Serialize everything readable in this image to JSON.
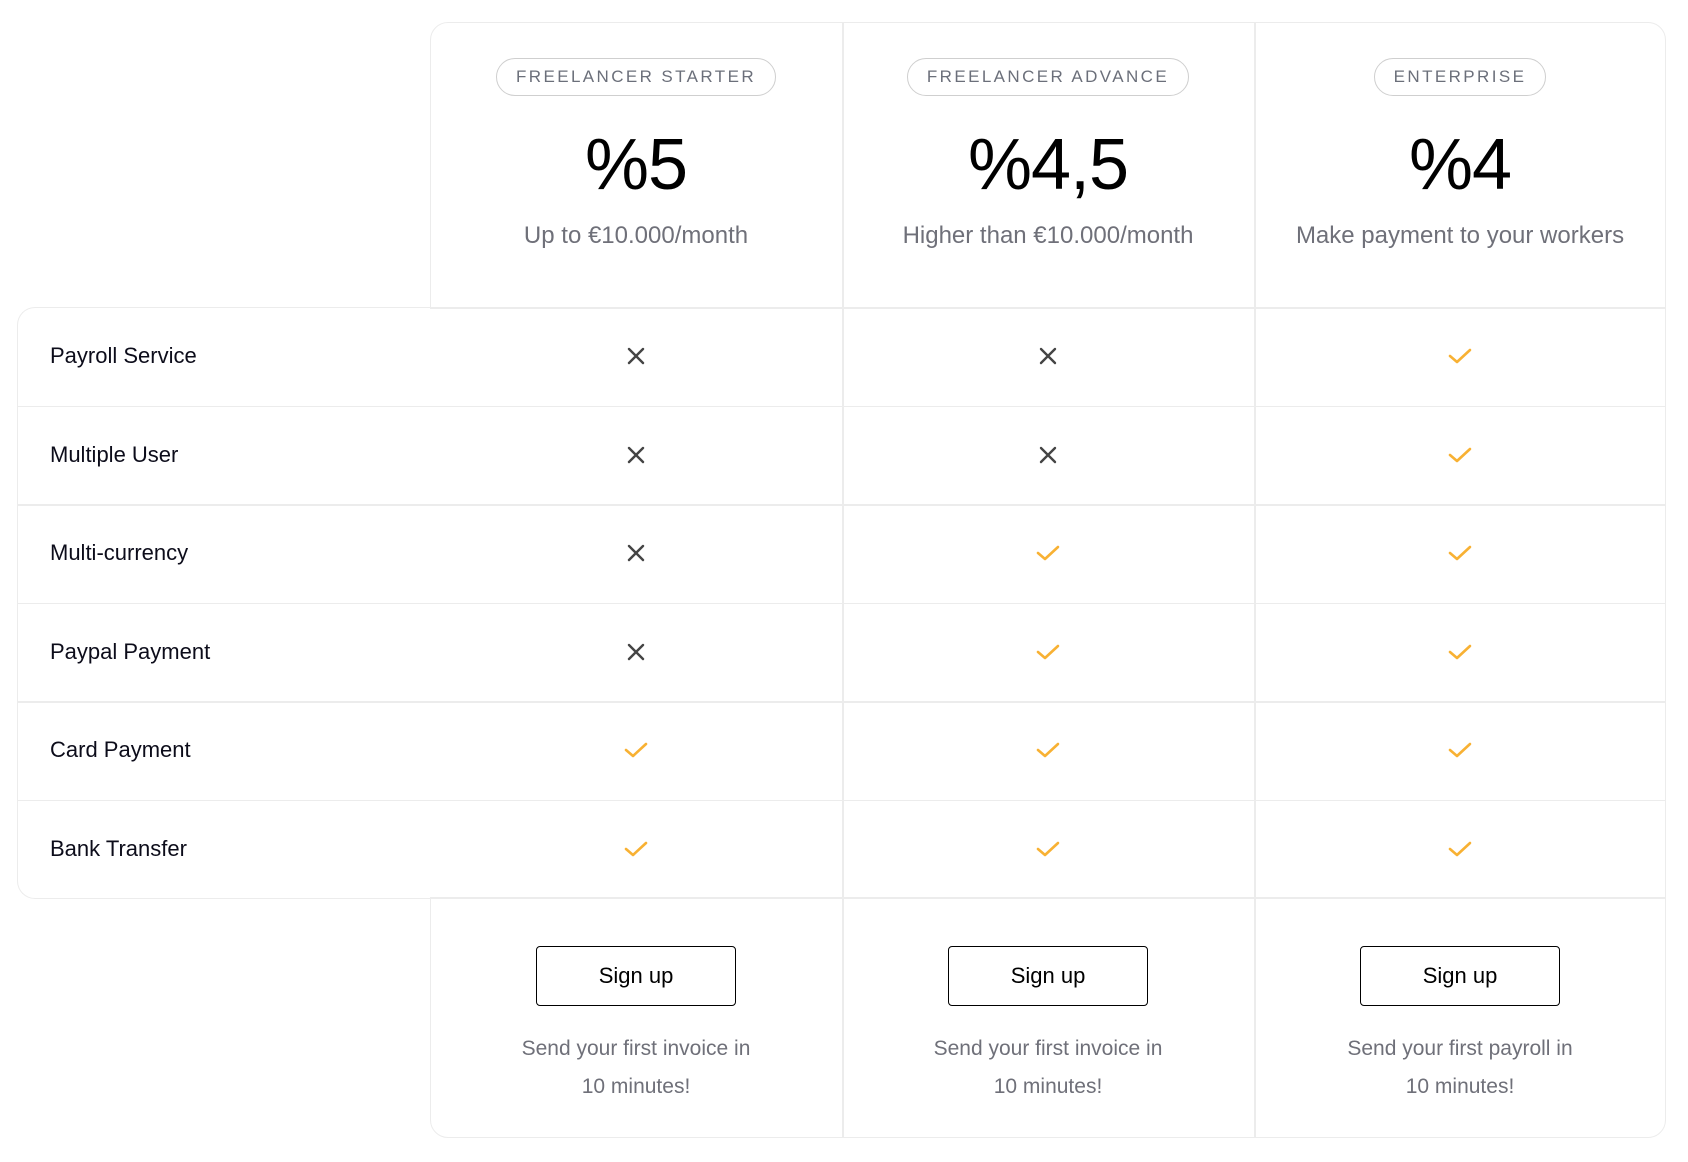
{
  "colors": {
    "check": "#F8B133",
    "cross": "#444444",
    "border": "#ECECEC",
    "muted": "#6F7079"
  },
  "plans": [
    {
      "badge": "FREELANCER STARTER",
      "price": "%5",
      "subtitle": "Up to €10.000/month",
      "button": "Sign up",
      "footer_line1": "Send your first invoice in",
      "footer_line2": "10 minutes!"
    },
    {
      "badge": "FREELANCER ADVANCE",
      "price": "%4,5",
      "subtitle": "Higher than €10.000/month",
      "button": "Sign up",
      "footer_line1": "Send your first invoice in",
      "footer_line2": "10 minutes!"
    },
    {
      "badge": "ENTERPRISE",
      "price": "%4",
      "subtitle": "Make payment to your workers",
      "button": "Sign up",
      "footer_line1": "Send your first payroll in",
      "footer_line2": "10 minutes!"
    }
  ],
  "features": [
    {
      "label": "Payroll Service",
      "included": [
        false,
        false,
        true
      ]
    },
    {
      "label": "Multiple User",
      "included": [
        false,
        false,
        true
      ]
    },
    {
      "label": "Multi-currency",
      "included": [
        false,
        true,
        true
      ]
    },
    {
      "label": "Paypal Payment",
      "included": [
        false,
        true,
        true
      ]
    },
    {
      "label": "Card Payment",
      "included": [
        true,
        true,
        true
      ]
    },
    {
      "label": "Bank Transfer",
      "included": [
        true,
        true,
        true
      ]
    }
  ]
}
